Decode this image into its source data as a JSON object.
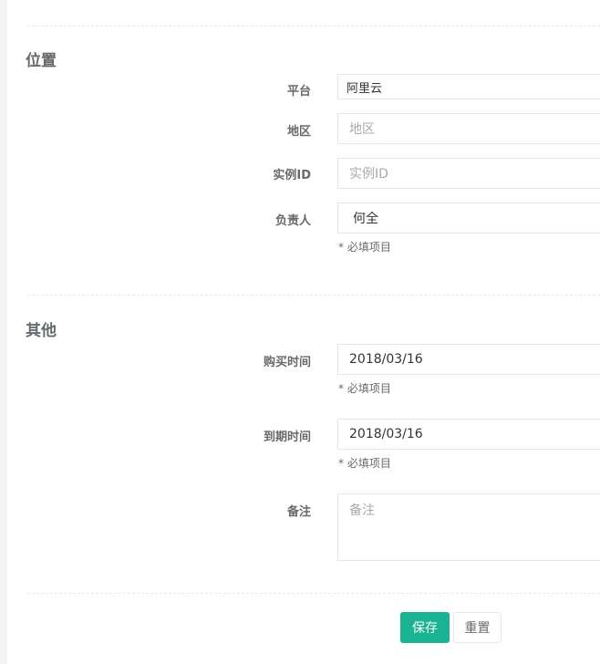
{
  "sections": {
    "location": {
      "title": "位置"
    },
    "other": {
      "title": "其他"
    }
  },
  "fields": {
    "platform": {
      "label": "平台",
      "value": "阿里云"
    },
    "region": {
      "label": "地区",
      "placeholder": "地区"
    },
    "instance_id": {
      "label": "实例ID",
      "placeholder": "实例ID"
    },
    "owner": {
      "label": "负责人",
      "value": "何全",
      "help": "* 必填项目"
    },
    "purchase_date": {
      "label": "购买时间",
      "value": "2018/03/16",
      "help": "* 必填项目"
    },
    "expire_date": {
      "label": "到期时间",
      "value": "2018/03/16",
      "help": "* 必填项目"
    },
    "remark": {
      "label": "备注",
      "placeholder": "备注"
    }
  },
  "buttons": {
    "save": "保存",
    "reset": "重置"
  },
  "colors": {
    "primary": "#1ab394",
    "text": "#676a6c",
    "border": "#e5e6e7"
  }
}
